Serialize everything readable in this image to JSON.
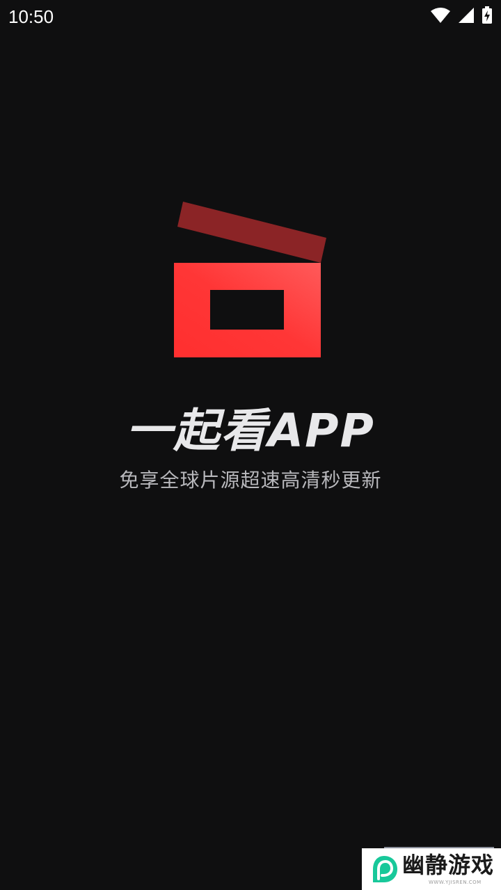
{
  "status_bar": {
    "time": "10:50",
    "icons": [
      "wifi-icon",
      "cell-signal-icon",
      "battery-charging-icon"
    ]
  },
  "splash": {
    "logo_icon": "clapperboard-icon",
    "title": "一起看APP",
    "subtitle": "免享全球片源超速高清秒更新"
  },
  "watermark": {
    "logo_icon": "leaf-logo-icon",
    "text": "幽静游戏",
    "url": "WWW.YJISREN.COM"
  },
  "colors": {
    "background": "#0f0f10",
    "logo_red": "#ff3a3a",
    "logo_dark_red": "#8b2426",
    "title": "#e8e8ea",
    "subtitle": "#b8b8bc",
    "watermark_green": "#18c89a"
  }
}
